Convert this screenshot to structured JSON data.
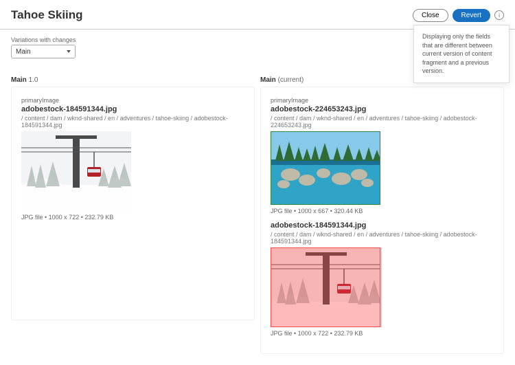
{
  "header": {
    "title": "Tahoe Skiing",
    "close_label": "Close",
    "revert_label": "Revert"
  },
  "controls": {
    "variations_label": "Variations with changes",
    "selected": "Main"
  },
  "tooltip": {
    "text": "Displaying only the fields that are different between current version of content fragment and a previous version."
  },
  "left": {
    "head_bold": "Main",
    "head_rest": "1.0",
    "items": [
      {
        "field": "primaryImage",
        "filename": "adobestock-184591344.jpg",
        "path": "/ content / dam / wknd-shared / en / adventures / tahoe-skiing / adobestock-184591344.jpg",
        "meta": "JPG file • 1000 x 722 • 232.79 KB"
      }
    ]
  },
  "right": {
    "head_bold": "Main",
    "head_rest": "(current)",
    "items": [
      {
        "field": "primaryImage",
        "filename": "adobestock-224653243.jpg",
        "path": "/ content / dam / wknd-shared / en / adventures / tahoe-skiing / adobestock-224653243.jpg",
        "meta": "JPG file • 1000 x 667 • 320.44 KB"
      },
      {
        "field": "",
        "filename": "adobestock-184591344.jpg",
        "path": "/ content / dam / wknd-shared / en / adventures / tahoe-skiing / adobestock-184591344.jpg",
        "meta": "JPG file • 1000 x 722 • 232.79 KB"
      }
    ]
  }
}
